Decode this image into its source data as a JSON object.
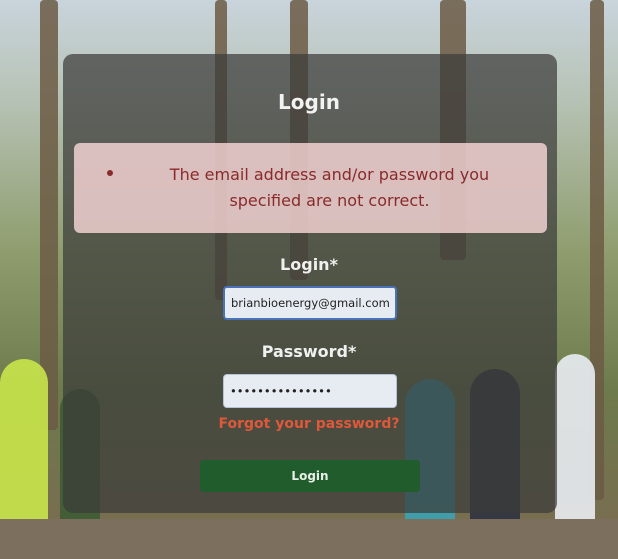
{
  "form": {
    "title": "Login",
    "error_message": "The email address and/or password you specified are not correct.",
    "email_label": "Login*",
    "email_value": "brianbioenergy@gmail.com",
    "password_label": "Password*",
    "password_value": "•••••••••••••••",
    "forgot_link": "Forgot your password?",
    "submit_label": "Login"
  },
  "colors": {
    "error_text": "#8a2a2a",
    "error_bg": "#f6d6d6",
    "link": "#e0583a",
    "button": "#215c2c"
  }
}
